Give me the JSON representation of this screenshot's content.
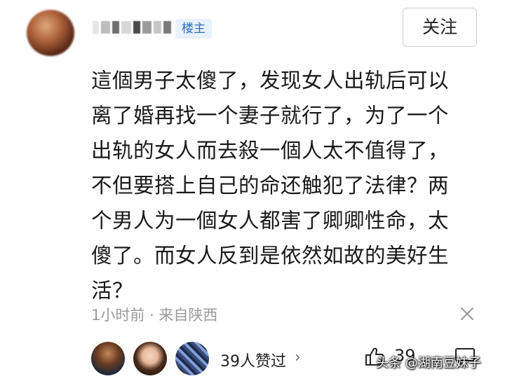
{
  "header": {
    "op_badge": "楼主",
    "follow_label": "关注"
  },
  "comment": {
    "lines": [
      "這個男子太傻了，发现女人出轨后可以",
      "离了婚再找一个妻子就行了，为了一个",
      "出轨的女人而去殺一個人太不值得了，",
      "不但要搭上自己的命还触犯了法律？两",
      "个男人为一個女人都害了卿卿性命，太",
      "傻了。而女人反到是依然如故的美好生",
      "活？"
    ]
  },
  "meta": {
    "time_location": "1小时前 · 来自陕西"
  },
  "footer": {
    "likes_summary": "39人赞过",
    "chevron": "›",
    "like_count": "39",
    "watermark": "头条 @湖南豆妹子"
  },
  "icons": {
    "close": "close-icon",
    "thumb": "thumb-up-icon",
    "comment": "comment-icon"
  },
  "colors": {
    "badge_bg": "#e8f1fc",
    "badge_text": "#2d6cc0",
    "meta_text": "#9a9a9a"
  }
}
